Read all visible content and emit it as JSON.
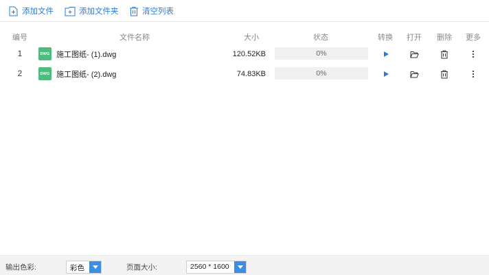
{
  "toolbar": {
    "add_file": "添加文件",
    "add_folder": "添加文件夹",
    "clear_list": "清空列表"
  },
  "table": {
    "headers": {
      "index": "编号",
      "filename": "文件名称",
      "size": "大小",
      "status": "状态",
      "convert": "转换",
      "open": "打开",
      "delete": "删除",
      "more": "更多"
    },
    "rows": [
      {
        "index": "1",
        "icon_label": "DWG",
        "name": "施工图纸- (1).dwg",
        "size": "120.52KB",
        "progress": "0%"
      },
      {
        "index": "2",
        "icon_label": "DWG",
        "name": "施工图纸- (2).dwg",
        "size": "74.83KB",
        "progress": "0%"
      }
    ]
  },
  "bottom": {
    "color_label": "输出色彩:",
    "color_value": "彩色",
    "page_label": "页面大小:",
    "page_value": "2560 * 1600"
  },
  "icons": {
    "add_file": "add-file-icon",
    "add_folder": "add-folder-icon",
    "clear": "trash-icon",
    "convert": "play-icon",
    "open": "folder-open-icon",
    "delete": "trash-icon",
    "more": "more-vertical-icon",
    "file_type": "dwg-file-icon"
  },
  "colors": {
    "accent": "#2e7bd6",
    "file_icon": "#4dbd7e",
    "select_arrow": "#3d8ee0"
  }
}
